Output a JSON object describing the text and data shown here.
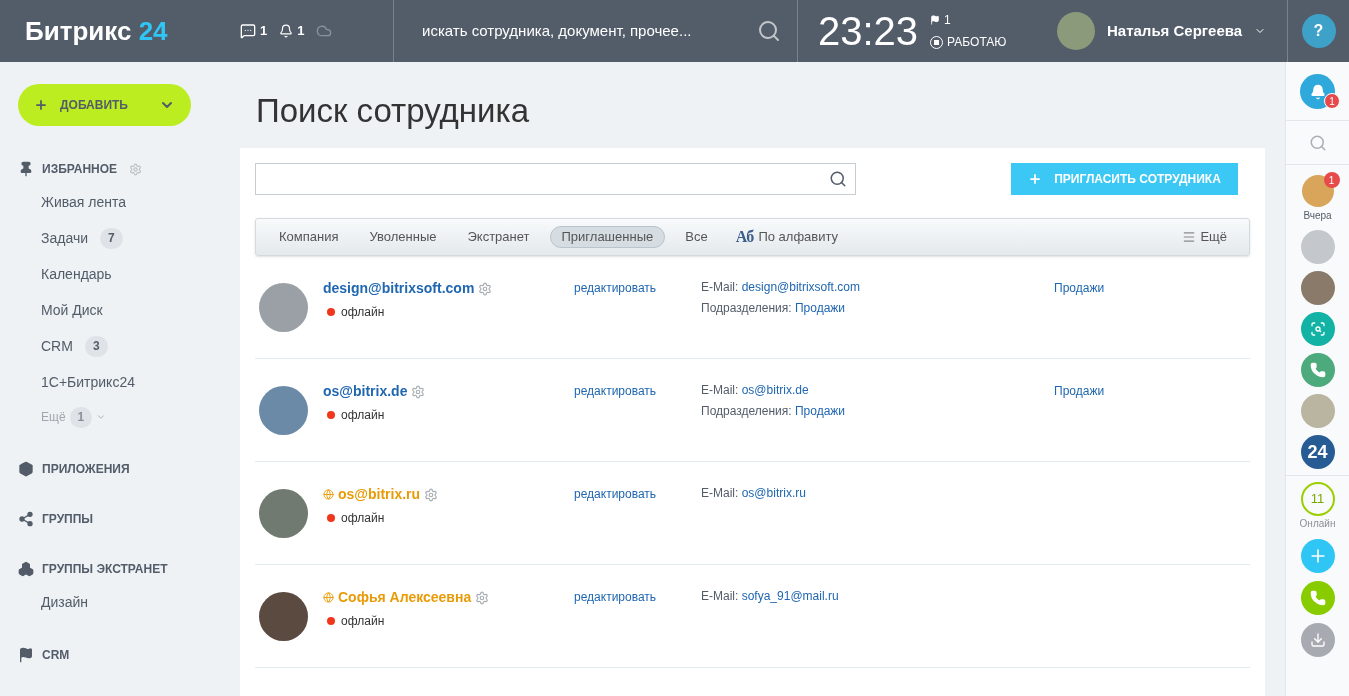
{
  "header": {
    "logo": {
      "text": "Битрикс",
      "accent": "24"
    },
    "messages_count": "1",
    "notifications_count": "1",
    "search": {
      "placeholder": "искать сотрудника, документ, прочее..."
    },
    "time": "23:23",
    "flag_count": "1",
    "work_status": "РАБОТАЮ",
    "user_name": "Наталья Сергеева",
    "help": "?"
  },
  "sidebar": {
    "add_button": "ДОБАВИТЬ",
    "sections": [
      {
        "title": "ИЗБРАННОЕ",
        "settings": true,
        "items": [
          {
            "label": "Живая лента"
          },
          {
            "label": "Задачи",
            "counter": "7"
          },
          {
            "label": "Календарь"
          },
          {
            "label": "Мой Диск"
          },
          {
            "label": "CRM",
            "counter": "3"
          },
          {
            "label": "1С+Битрикс24"
          }
        ],
        "more": {
          "label": "Ещё",
          "counter": "1"
        }
      },
      {
        "title": "ПРИЛОЖЕНИЯ",
        "settings": false
      },
      {
        "title": "ГРУППЫ",
        "settings": false
      },
      {
        "title": "ГРУППЫ ЭКСТРАНЕТ",
        "settings": false,
        "items": [
          {
            "label": "Дизайн"
          }
        ]
      },
      {
        "title": "CRM",
        "settings": false
      }
    ]
  },
  "page_title": "Поиск сотрудника",
  "invite_button": "ПРИГЛАСИТЬ СОТРУДНИКА",
  "tabs": [
    {
      "label": "Компания",
      "selected": false
    },
    {
      "label": "Уволенные",
      "selected": false
    },
    {
      "label": "Экстранет",
      "selected": false
    },
    {
      "label": "Приглашенные",
      "selected": true
    },
    {
      "label": "Все",
      "selected": false
    }
  ],
  "alphabet": {
    "glyph": "Аб",
    "label": "По алфавиту"
  },
  "more": "Ещё",
  "employees": [
    {
      "name": "design@bitrixsoft.com",
      "kind": "user",
      "status": "офлайн",
      "edit": "редактировать",
      "email_label": "E-Mail:",
      "email": "design@bitrixsoft.com",
      "department_label": "Подразделения:",
      "department": "Продажи",
      "department_link": "Продажи"
    },
    {
      "name": "os@bitrix.de",
      "kind": "user",
      "status": "офлайн",
      "edit": "редактировать",
      "email_label": "E-Mail:",
      "email": "os@bitrix.de",
      "department_label": "Подразделения:",
      "department": "Продажи",
      "department_link": "Продажи"
    },
    {
      "name": "os@bitrix.ru",
      "kind": "extranet",
      "status": "офлайн",
      "edit": "редактировать",
      "email_label": "E-Mail:",
      "email": "os@bitrix.ru"
    },
    {
      "name": "Софья Алексеевна",
      "kind": "extranet",
      "status": "офлайн",
      "edit": "редактировать",
      "email_label": "E-Mail:",
      "email": "sofya_91@mail.ru"
    }
  ],
  "right_bar": {
    "notifications_badge": "1",
    "chat_badge": "1",
    "chat_caption": "Вчера",
    "logo_text": "24",
    "online_count": "11",
    "online_label": "Онлайн"
  }
}
